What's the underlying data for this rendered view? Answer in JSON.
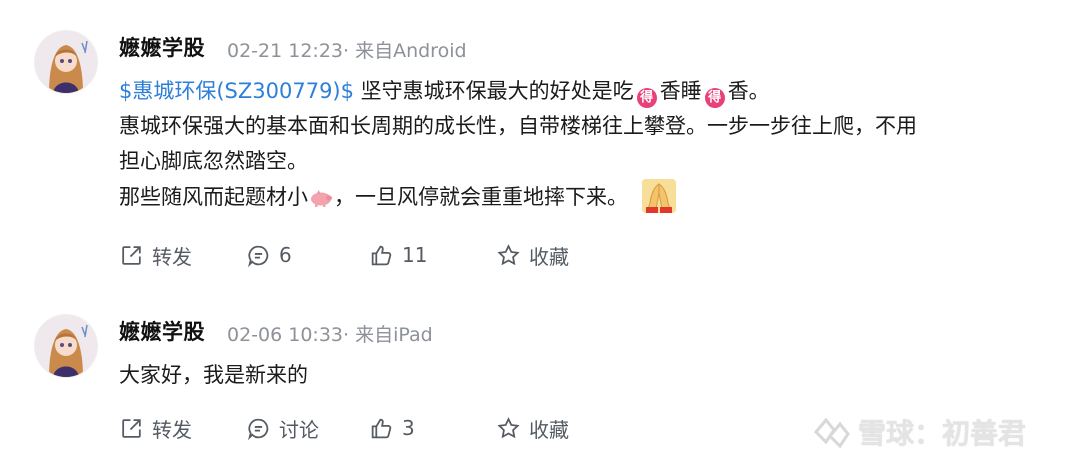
{
  "posts": [
    {
      "author": "嬷嬷学股",
      "meta": "02-21 12:23· 来自Android",
      "stock_link": "$惠城环保(SZ300779)$",
      "line1_a": " 坚守惠城环保最大的好处是吃",
      "emoji_de": "得",
      "line1_b": "香睡",
      "line1_c": "香。",
      "line2": "惠城环保强大的基本面和长周期的成长性，自带楼梯往上攀登。一步一步往上爬，不用",
      "line3": "担心脚底忽然踏空。",
      "line4_a": "那些随风而起题材小",
      "line4_b": "，一旦风停就会重重地摔下来。",
      "actions": {
        "share": "转发",
        "comment": "6",
        "like": "11",
        "favorite": "收藏"
      }
    },
    {
      "author": "嬷嬷学股",
      "meta": "02-06 10:33· 来自iPad",
      "text": "大家好，我是新来的",
      "actions": {
        "share": "转发",
        "comment": "讨论",
        "like": "3",
        "favorite": "收藏"
      }
    }
  ],
  "watermark": "雪球：初善君",
  "icons": [
    "avatar",
    "share-icon",
    "comment-icon",
    "like-icon",
    "favorite-icon",
    "pig-emoji-icon",
    "pray-emoji-icon",
    "xueqiu-logo-icon"
  ],
  "colors": {
    "link": "#2d7fd8",
    "meta": "#8d9299",
    "emoji": "#e8417a"
  }
}
